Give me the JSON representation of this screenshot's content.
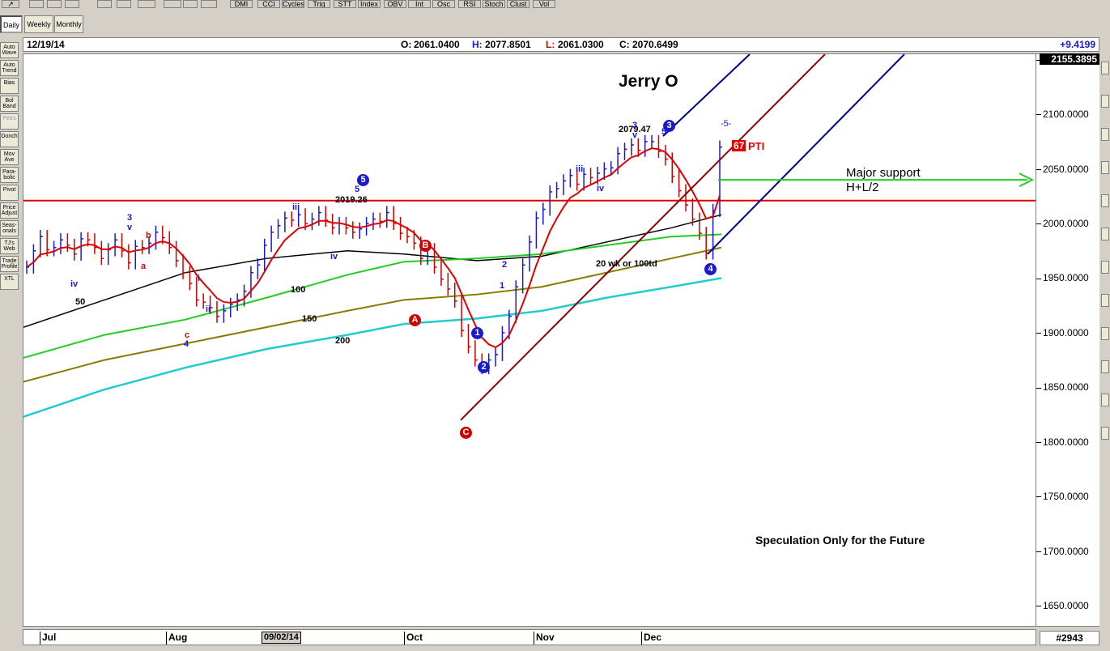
{
  "toolbar": {
    "top_buttons": [
      "DMI",
      "CCI",
      "Cycles",
      "Trig",
      "STT",
      "Index",
      "OBV",
      "Int",
      "Osc",
      "RSI",
      "Stoch",
      "Clust",
      "Vol"
    ],
    "period_buttons": [
      {
        "label": "Daily",
        "active": true
      },
      {
        "label": "Weekly",
        "active": false
      },
      {
        "label": "Monthly",
        "active": false
      }
    ]
  },
  "sidebar": {
    "items": [
      {
        "label": "Auto Wave",
        "dim": false
      },
      {
        "label": "Auto Trend",
        "dim": false
      },
      {
        "label": "Bias",
        "dim": false
      },
      {
        "label": "Bol Band",
        "dim": false
      },
      {
        "label": "Petrs",
        "dim": true
      },
      {
        "label": "Donch",
        "dim": false
      },
      {
        "label": "Mov Ave",
        "dim": false
      },
      {
        "label": "Para-bolic",
        "dim": false
      },
      {
        "label": "Pivot",
        "dim": false
      },
      {
        "label": "Price Adjust",
        "dim": false
      },
      {
        "label": "Seas-onals",
        "dim": false
      },
      {
        "label": "TJ's Web",
        "dim": false
      },
      {
        "label": "Trade Profile",
        "dim": false
      },
      {
        "label": "XTL",
        "dim": false
      }
    ]
  },
  "status": {
    "date": "12/19/14",
    "open_label": "O:",
    "open": "2061.0400",
    "high_label": "H:",
    "high": "2077.8501",
    "low_label": "L:",
    "low": "2061.0300",
    "close_label": "C:",
    "close": "2070.6499",
    "change": "+9.4199",
    "change_color": "#1a1acc"
  },
  "axis": {
    "y_ticks": [
      "2150.0000",
      "2100.0000",
      "2050.0000",
      "2000.0000",
      "1950.0000",
      "1900.0000",
      "1850.0000",
      "1800.0000",
      "1750.0000",
      "1700.0000",
      "1650.0000"
    ],
    "last_price": "2155.3895",
    "x_labels": [
      "Jul",
      "Aug",
      "Oct",
      "Nov",
      "Dec"
    ],
    "date_flag": "09/02/14",
    "bar_count": "#2943"
  },
  "annotations": {
    "author": "Jerry O",
    "support_line1": "Major support",
    "support_line2": "H+L/2",
    "speculation": "Speculation Only for the Future",
    "pti_value": "67",
    "pti_label": "PTI",
    "ma_label_50": "50",
    "ma_label_100": "100",
    "ma_label_150": "150",
    "ma_label_200": "200",
    "ma_note": "20 wk or 100td",
    "price_2019": "2019.26",
    "price_2079": "2079.47",
    "wave_5_future": "-5-",
    "wave_labels": [
      {
        "t": "3",
        "c": "#1a1acc"
      },
      {
        "t": "v",
        "c": "#1a1acc"
      },
      {
        "t": "b",
        "c": "#d00000"
      },
      {
        "t": "a",
        "c": "#d00000"
      },
      {
        "t": "iv",
        "c": "#1a1acc"
      },
      {
        "t": "i",
        "c": "#1a1acc"
      },
      {
        "t": "ii",
        "c": "#1a1acc"
      },
      {
        "t": "c",
        "c": "#d00000"
      },
      {
        "t": "4",
        "c": "#1a1acc"
      },
      {
        "t": "iii",
        "c": "#1a1acc"
      },
      {
        "t": "5",
        "c": "#1a1acc"
      },
      {
        "t": "iv",
        "c": "#1a1acc"
      },
      {
        "t": "iii",
        "c": "#1a1acc"
      },
      {
        "t": "iv",
        "c": "#1a1acc"
      },
      {
        "t": "3",
        "c": "#1a1acc"
      },
      {
        "t": "v",
        "c": "#1a1acc"
      },
      {
        "t": "5",
        "c": "#1a1acc"
      },
      {
        "t": "1",
        "c": "#1a1acc"
      },
      {
        "t": "2",
        "c": "#1a1acc"
      }
    ],
    "circle_labels": [
      {
        "t": "5",
        "fill": "#1a1acc"
      },
      {
        "t": "B",
        "fill": "#d00000"
      },
      {
        "t": "A",
        "fill": "#d00000"
      },
      {
        "t": "C",
        "fill": "#d00000"
      },
      {
        "t": "1",
        "fill": "#1a1acc"
      },
      {
        "t": "2",
        "fill": "#1a1acc"
      },
      {
        "t": "3",
        "fill": "#1a1acc"
      },
      {
        "t": "4",
        "fill": "#1a1acc"
      }
    ]
  },
  "colors": {
    "price_bars_up": "#1a1acc",
    "price_bars_down": "#d00000",
    "ma_fast": "#e00000",
    "ma_50": "#000000",
    "ma_100": "#22cc22",
    "ma_150": "#8b7a00",
    "ma_200": "#22cccc",
    "support_line": "#e00000",
    "arrow": "#22cc22",
    "fork_median": "#8b0000",
    "fork_tines": "#00008b"
  },
  "chart_data": {
    "type": "bar",
    "title": "",
    "instrument_interval": "Daily",
    "ylim": [
      1630,
      2155
    ],
    "y_ticks": [
      1650,
      1700,
      1750,
      1800,
      1850,
      1900,
      1950,
      2000,
      2050,
      2100,
      2150
    ],
    "x_ticks": [
      "Jul",
      "Aug",
      "Oct",
      "Nov",
      "Dec"
    ],
    "ohlc_date_shown": "12/19/14",
    "ohlc": {
      "open": 2061.04,
      "high": 2077.8501,
      "low": 2061.03,
      "close": 2070.6499
    },
    "horizontal_levels": [
      {
        "name": "Major support H+L/2",
        "value": 2021
      }
    ],
    "closes_approx": [
      1960,
      1975,
      1988,
      1976,
      1978,
      1985,
      1980,
      1972,
      1986,
      1985,
      1978,
      1968,
      1976,
      1985,
      1975,
      1964,
      1979,
      1978,
      1982,
      1992,
      1987,
      1978,
      1966,
      1955,
      1945,
      1930,
      1928,
      1923,
      1915,
      1920,
      1926,
      1930,
      1938,
      1955,
      1962,
      1980,
      1992,
      1998,
      2005,
      2003,
      2008,
      2000,
      2004,
      2010,
      2003,
      1996,
      2000,
      1996,
      1992,
      1995,
      2000,
      2004,
      2002,
      2010,
      2000,
      1991,
      1988,
      1982,
      1968,
      1976,
      1960,
      1949,
      1940,
      1929,
      1902,
      1887,
      1875,
      1868,
      1875,
      1880,
      1900,
      1915,
      1942,
      1962,
      1983,
      2005,
      2013,
      2029,
      2032,
      2039,
      2044,
      2036,
      2045,
      2042,
      2046,
      2050,
      2051,
      2064,
      2068,
      2072,
      2067,
      2075,
      2075,
      2066,
      2059,
      2043,
      2030,
      2017,
      2004,
      1991,
      1973,
      2012,
      2070
    ]
  }
}
